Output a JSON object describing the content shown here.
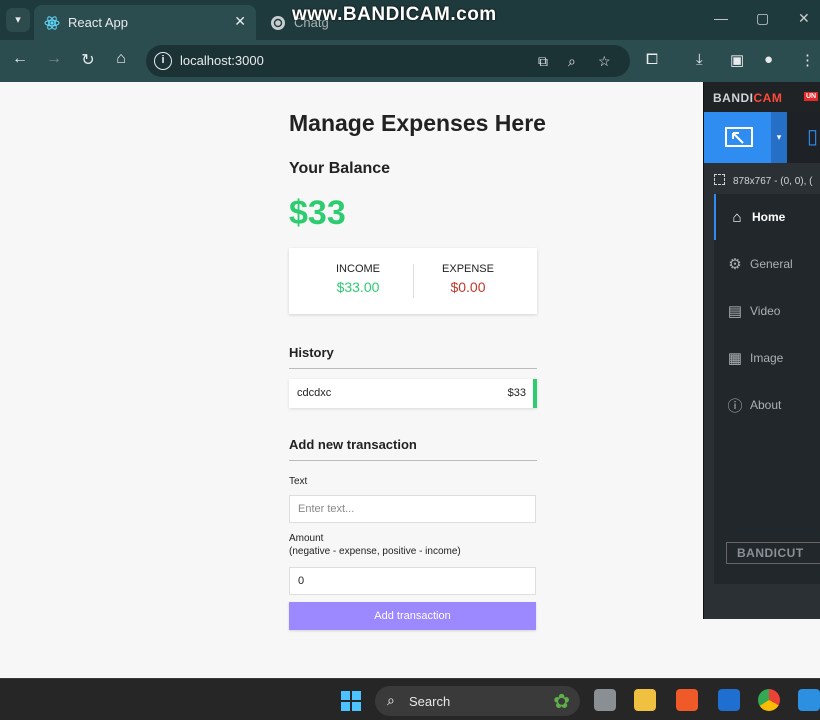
{
  "browser": {
    "tabs": [
      {
        "title": "React App",
        "active": true
      },
      {
        "title": "Chatg",
        "active": false
      }
    ],
    "url": "localhost:3000",
    "watermark": "www.BANDICAM.com"
  },
  "app": {
    "title": "Manage Expenses Here",
    "balance_label": "Your Balance",
    "balance": "$33",
    "income_label": "INCOME",
    "income": "$33.00",
    "expense_label": "EXPENSE",
    "expense": "$0.00",
    "history_title": "History",
    "history": [
      {
        "text": "cdcdxc",
        "amount": "$33"
      }
    ],
    "add_title": "Add new transaction",
    "text_label": "Text",
    "text_placeholder": "Enter text...",
    "amount_label": "Amount",
    "amount_hint": "(negative - expense, positive - income)",
    "amount_value": "0",
    "submit_label": "Add transaction"
  },
  "bandicam": {
    "logo_a": "BANDI",
    "logo_b": "CAM",
    "unreg": "UN",
    "resolution": "878x767 - (0, 0), (",
    "nav": [
      "Home",
      "General",
      "Video",
      "Image",
      "About"
    ],
    "bandicut": "BANDICUT"
  },
  "taskbar": {
    "search": "Search"
  },
  "colors": {
    "income": "#2ecc71",
    "expense": "#c0392b",
    "button": "#9c88ff",
    "accent": "#2f8cf0"
  }
}
